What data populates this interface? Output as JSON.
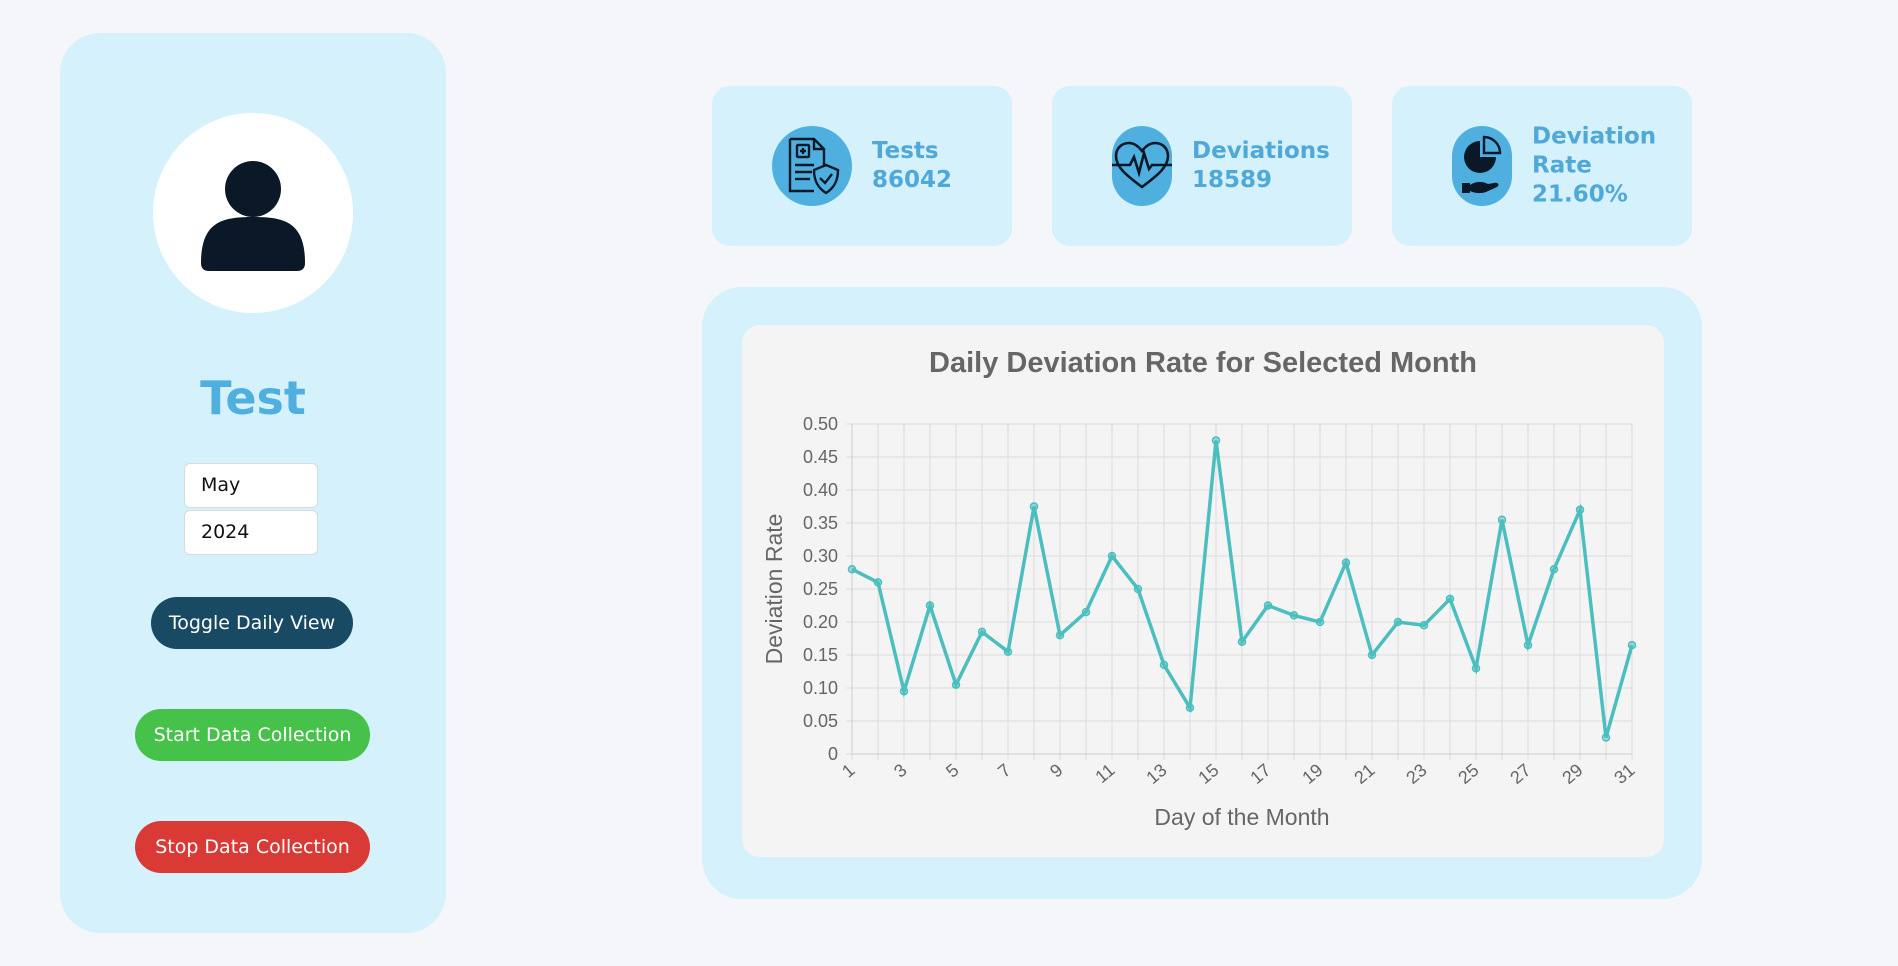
{
  "sidebar": {
    "username": "Test",
    "month": "May",
    "year": "2024",
    "toggle_label": "Toggle Daily View",
    "start_label": "Start Data Collection",
    "stop_label": "Stop Data Collection"
  },
  "stats": [
    {
      "label": "Tests",
      "value": "86042",
      "icon": "medical-report-icon"
    },
    {
      "label": "Deviations",
      "value": "18589",
      "icon": "heartbeat-icon"
    },
    {
      "label": "Deviation Rate",
      "label_line1": "Deviation",
      "label_line2": "Rate",
      "value": "21.60%",
      "icon": "pie-chart-hand-icon"
    }
  ],
  "colors": {
    "background": "#f4f6fa",
    "panel": "#d4f1fc",
    "accent": "#4fb0e0",
    "toggle": "#184a63",
    "start": "#46c24a",
    "stop": "#d93a35",
    "line": "#4bbfbf"
  },
  "chart_data": {
    "type": "line",
    "title": "Daily Deviation Rate for Selected Month",
    "xlabel": "Day of the Month",
    "ylabel": "Deviation Rate",
    "x": [
      1,
      2,
      3,
      4,
      5,
      6,
      7,
      8,
      9,
      10,
      11,
      12,
      13,
      14,
      15,
      16,
      17,
      18,
      19,
      20,
      21,
      22,
      23,
      24,
      25,
      26,
      27,
      28,
      29,
      30,
      31
    ],
    "x_tick_labels": [
      "1",
      "3",
      "5",
      "7",
      "9",
      "11",
      "13",
      "15",
      "17",
      "19",
      "21",
      "23",
      "25",
      "27",
      "29",
      "31"
    ],
    "y_tick_labels": [
      "0",
      "0.05",
      "0.10",
      "0.15",
      "0.20",
      "0.25",
      "0.30",
      "0.35",
      "0.40",
      "0.45",
      "0.50"
    ],
    "series": [
      {
        "values": [
          0.28,
          0.26,
          0.095,
          0.225,
          0.105,
          0.185,
          0.155,
          0.375,
          0.18,
          0.215,
          0.3,
          0.25,
          0.135,
          0.07,
          0.475,
          0.17,
          0.225,
          0.21,
          0.2,
          0.29,
          0.15,
          0.2,
          0.195,
          0.235,
          0.13,
          0.355,
          0.165,
          0.28,
          0.37,
          0.025,
          0.165
        ]
      }
    ],
    "ylim": [
      0,
      0.5
    ],
    "xlim": [
      1,
      31
    ],
    "grid": true,
    "legend": false
  }
}
